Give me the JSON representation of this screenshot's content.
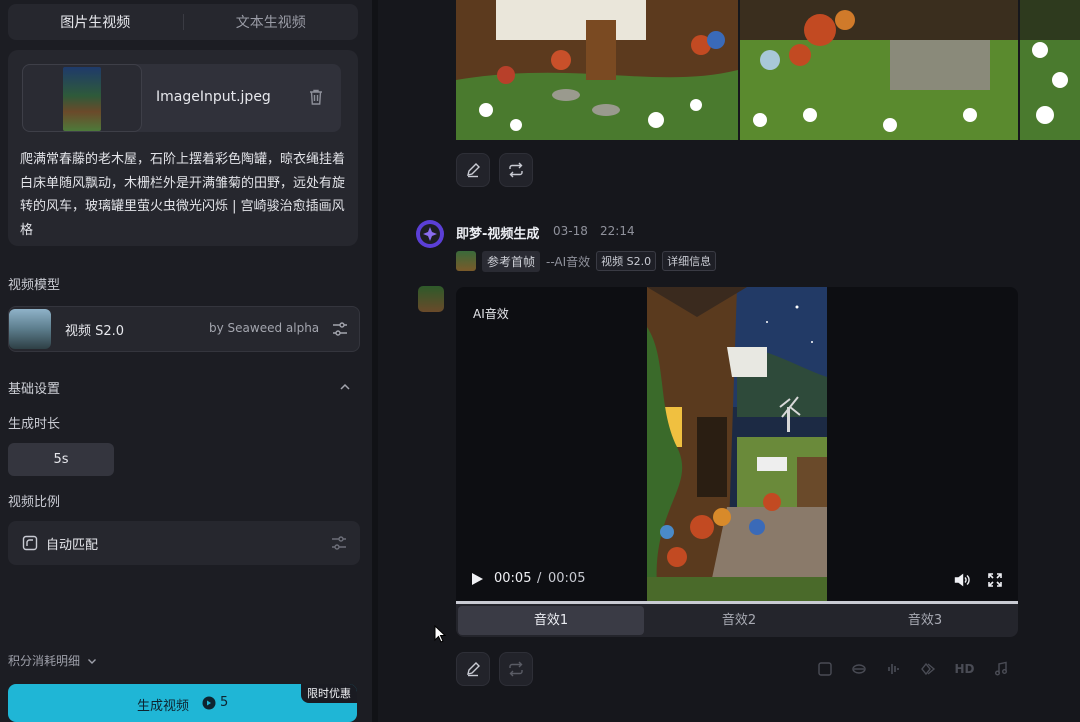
{
  "tabs": [
    {
      "label": "图片生视频",
      "active": true
    },
    {
      "label": "文本生视频",
      "active": false
    }
  ],
  "upload": {
    "file_name": "ImageInput.jpeg",
    "prompt": "爬满常春藤的老木屋，石阶上摆着彩色陶罐，晾衣绳挂着白床单随风飘动，木栅栏外是开满雏菊的田野，远处有旋转的风车，玻璃罐里萤火虫微光闪烁 | 宫崎骏治愈插画风格"
  },
  "model": {
    "section_label": "视频模型",
    "name": "视频 S2.0",
    "provider": "by Seaweed alpha"
  },
  "basic_settings": {
    "title": "基础设置",
    "duration_label": "生成时长",
    "duration_value": "5s",
    "ratio_label": "视频比例",
    "ratio_value": "自动匹配"
  },
  "footer": {
    "points_label": "积分消耗明细",
    "generate_label": "生成视频",
    "generate_cost": "5",
    "promo_badge": "限时优惠"
  },
  "message": {
    "bot_name": "即梦-视频生成",
    "date": "03-18",
    "time": "22:14",
    "ref_label": "参考首帧",
    "audio_flag": "--AI音效",
    "tags": [
      "视频 S2.0",
      "详细信息"
    ]
  },
  "video": {
    "label": "AI音效",
    "current_time": "00:05",
    "separator": "/",
    "duration": "00:05",
    "progress": 1.0,
    "sound_tabs": [
      {
        "label": "音效1",
        "active": true
      },
      {
        "label": "音效2",
        "active": false
      },
      {
        "label": "音效3",
        "active": false
      }
    ]
  },
  "toolbar": {
    "hd_label": "HD"
  },
  "colors": {
    "accent": "#1fb6d6",
    "bot_avatar": "#5b3fd6",
    "background": "#16171c",
    "panel": "#1c1d23"
  }
}
